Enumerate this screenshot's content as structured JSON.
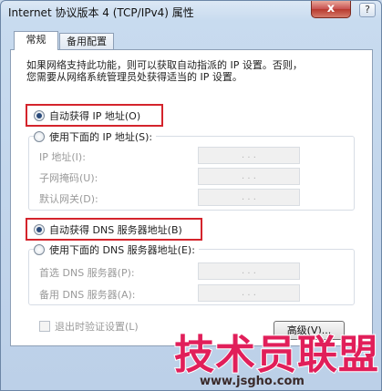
{
  "window": {
    "title": "Internet 协议版本 4 (TCP/IPv4) 属性",
    "close_glyph": "x",
    "help_glyph": "?"
  },
  "tabs": [
    {
      "label": "常规",
      "active": true
    },
    {
      "label": "备用配置",
      "active": false
    }
  ],
  "description_lines": [
    "如果网络支持此功能，则可以获取自动指派的 IP 设置。否则，",
    "您需要从网络系统管理员处获得适当的 IP 设置。"
  ],
  "ip_section": {
    "auto_label": "自动获得 IP 地址(O)",
    "manual_label": "使用下面的 IP 地址(S):",
    "selected": "auto",
    "fields": [
      {
        "label": "IP 地址(I):",
        "value": ". . ."
      },
      {
        "label": "子网掩码(U):",
        "value": ". . ."
      },
      {
        "label": "默认网关(D):",
        "value": ". . ."
      }
    ]
  },
  "dns_section": {
    "auto_label": "自动获得 DNS 服务器地址(B)",
    "manual_label": "使用下面的 DNS 服务器地址(E):",
    "selected": "auto",
    "fields": [
      {
        "label": "首选 DNS 服务器(P):",
        "value": ". . ."
      },
      {
        "label": "备用 DNS 服务器(A):",
        "value": ". . ."
      }
    ]
  },
  "validate_on_exit_label": "退出时验证设置(L)",
  "validate_on_exit_checked": false,
  "advanced_button": "高级(V)...",
  "watermark": {
    "main": "技术员联盟",
    "url": "www.jsgho.com"
  },
  "colors": {
    "highlight_box": "#d4242c",
    "watermark": "#e11f5a"
  }
}
